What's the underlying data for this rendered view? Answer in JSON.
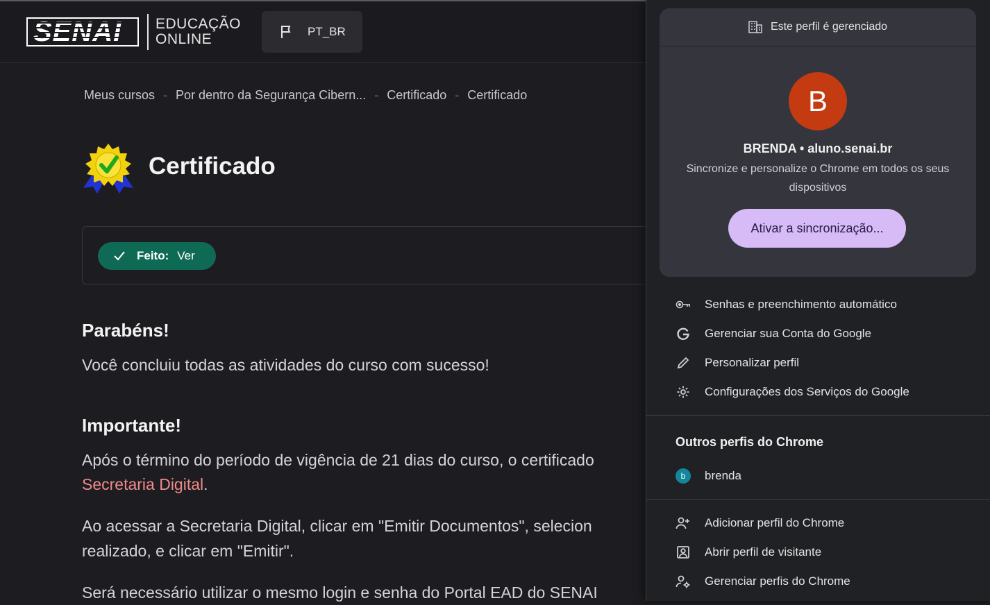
{
  "header": {
    "logo_text": "SENAI",
    "logo_sub_line1": "EDUCAÇÃO",
    "logo_sub_line2": "ONLINE",
    "language_label": "PT_BR"
  },
  "breadcrumb": {
    "items": [
      "Meus cursos",
      "Por dentro da Segurança Cibern...",
      "Certificado",
      "Certificado"
    ],
    "separator": "-"
  },
  "page": {
    "title": "Certificado",
    "status_label": "Feito:",
    "status_value": "Ver",
    "congrats_heading": "Parabéns!",
    "congrats_text": "Você concluiu todas as atividades do curso com sucesso!",
    "important_heading": "Importante!",
    "important_text_1": "Após o término do período de vigência de 21 dias do curso, o certificado",
    "important_link": "Secretaria Digital",
    "important_text_1_end": ".",
    "instructions_line1": "Ao acessar a Secretaria Digital, clicar em \"Emitir Documentos\", selecion",
    "instructions_line2": "realizado, e clicar em \"Emitir\".",
    "login_text": "Será necessário utilizar o mesmo login e senha do Portal EAD do SENAI"
  },
  "profile_panel": {
    "managed_label": "Este perfil é gerenciado",
    "avatar_letter": "B",
    "profile_name": "BRENDA • aluno.senai.br",
    "sync_description": "Sincronize e personalize o Chrome em todos os seus dispositivos",
    "sync_button": "Ativar a sincronização...",
    "menu": [
      {
        "label": "Senhas e preenchimento automático",
        "icon": "key-icon"
      },
      {
        "label": "Gerenciar sua Conta do Google",
        "icon": "google-icon"
      },
      {
        "label": "Personalizar perfil",
        "icon": "pencil-icon"
      },
      {
        "label": "Configurações dos Serviços do Google",
        "icon": "gear-icon"
      }
    ],
    "other_profiles_title": "Outros perfis do Chrome",
    "other_profiles": [
      {
        "name": "brenda",
        "avatar_letter": "b"
      }
    ],
    "bottom_menu": [
      {
        "label": "Adicionar perfil do Chrome",
        "icon": "add-person-icon"
      },
      {
        "label": "Abrir perfil de visitante",
        "icon": "guest-profile-icon"
      },
      {
        "label": "Gerenciar perfis do Chrome",
        "icon": "manage-profiles-icon"
      }
    ]
  },
  "colors": {
    "background": "#1d1d21",
    "badge_green": "#0f6a55",
    "link_red": "#f08a8a",
    "avatar_orange": "#c43b12",
    "sync_button_bg": "#d6bbf7"
  }
}
